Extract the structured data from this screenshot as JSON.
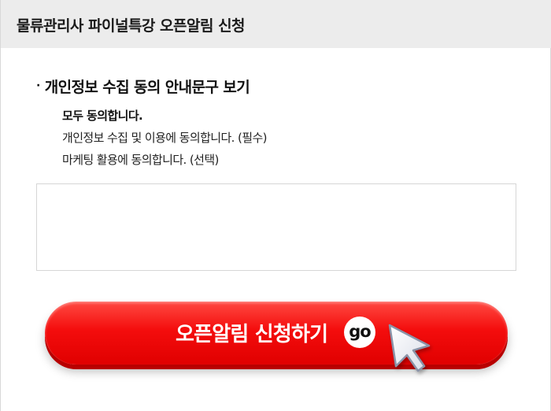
{
  "header": {
    "title": "물류관리사 파이널특강 오픈알림 신청"
  },
  "privacy": {
    "bullet": "·",
    "title": "개인정보 수집 동의 안내문구 보기",
    "items": [
      "모두 동의합니다.",
      "개인정보 수집 및 이용에 동의합니다. (필수)",
      "마케팅 활용에 동의합니다. (선택)"
    ],
    "notice_text": ""
  },
  "cta": {
    "label": "오픈알림 신청하기",
    "badge": "go"
  },
  "colors": {
    "header_bg": "#ececec",
    "cta_red": "#f40d0d",
    "cursor_fill": "#eef0f6"
  },
  "icons": {
    "cursor": "pointer-cursor-icon"
  }
}
